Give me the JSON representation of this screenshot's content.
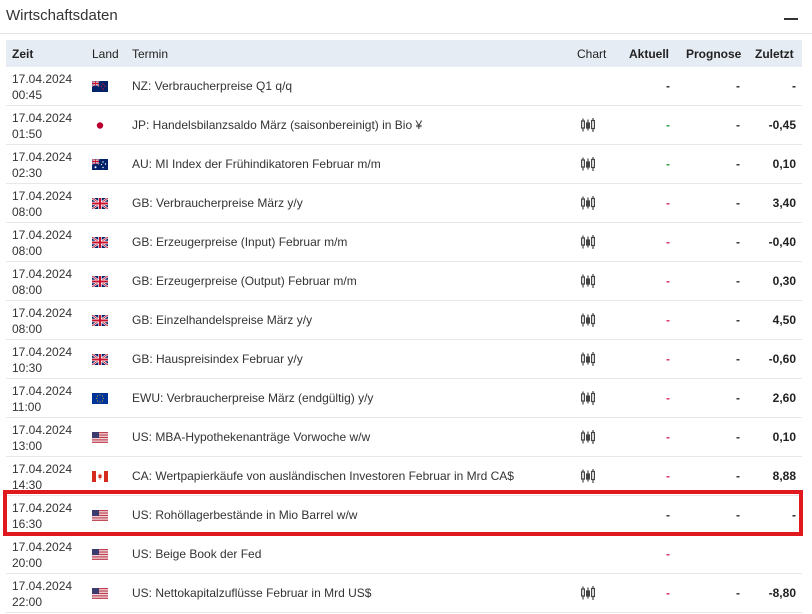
{
  "widget": {
    "title": "Wirtschaftsdaten",
    "collapse_icon": "minus-icon"
  },
  "table": {
    "headers": {
      "time": "Zeit",
      "country": "Land",
      "term": "Termin",
      "chart": "Chart",
      "actual": "Aktuell",
      "forecast": "Prognose",
      "previous": "Zuletzt"
    },
    "rows": [
      {
        "date": "17.04.2024",
        "time": "00:45",
        "flag": "nz",
        "term": "NZ: Verbraucherpreise Q1 q/q",
        "chart": false,
        "actual": "-",
        "actual_style": "plain",
        "forecast": "-",
        "previous": "-"
      },
      {
        "date": "17.04.2024",
        "time": "01:50",
        "flag": "jp",
        "term": "JP: Handelsbilanzsaldo März (saisonbereinigt) in Bio ¥",
        "chart": true,
        "actual": "-",
        "actual_style": "green",
        "forecast": "-",
        "previous": "-0,45"
      },
      {
        "date": "17.04.2024",
        "time": "02:30",
        "flag": "au",
        "term": "AU: MI Index der Frühindikatoren Februar m/m",
        "chart": true,
        "actual": "-",
        "actual_style": "green",
        "forecast": "-",
        "previous": "0,10"
      },
      {
        "date": "17.04.2024",
        "time": "08:00",
        "flag": "gb",
        "term": "GB: Verbraucherpreise März y/y",
        "chart": true,
        "actual": "-",
        "actual_style": "red",
        "forecast": "-",
        "previous": "3,40"
      },
      {
        "date": "17.04.2024",
        "time": "08:00",
        "flag": "gb",
        "term": "GB: Erzeugerpreise (Input) Februar m/m",
        "chart": true,
        "actual": "-",
        "actual_style": "red",
        "forecast": "-",
        "previous": "-0,40"
      },
      {
        "date": "17.04.2024",
        "time": "08:00",
        "flag": "gb",
        "term": "GB: Erzeugerpreise (Output) Februar m/m",
        "chart": true,
        "actual": "-",
        "actual_style": "red",
        "forecast": "-",
        "previous": "0,30"
      },
      {
        "date": "17.04.2024",
        "time": "08:00",
        "flag": "gb",
        "term": "GB: Einzelhandelspreise März y/y",
        "chart": true,
        "actual": "-",
        "actual_style": "red",
        "forecast": "-",
        "previous": "4,50"
      },
      {
        "date": "17.04.2024",
        "time": "10:30",
        "flag": "gb",
        "term": "GB: Hauspreisindex Februar y/y",
        "chart": true,
        "actual": "-",
        "actual_style": "red",
        "forecast": "-",
        "previous": "-0,60"
      },
      {
        "date": "17.04.2024",
        "time": "11:00",
        "flag": "eu",
        "term": "EWU: Verbraucherpreise März (endgültig) y/y",
        "chart": true,
        "actual": "-",
        "actual_style": "red",
        "forecast": "-",
        "previous": "2,60"
      },
      {
        "date": "17.04.2024",
        "time": "13:00",
        "flag": "us",
        "term": "US: MBA-Hypothekenanträge Vorwoche w/w",
        "chart": true,
        "actual": "-",
        "actual_style": "red",
        "forecast": "-",
        "previous": "0,10"
      },
      {
        "date": "17.04.2024",
        "time": "14:30",
        "flag": "ca",
        "term": "CA: Wertpapierkäufe von ausländischen Investoren Februar in Mrd CA$",
        "chart": true,
        "actual": "-",
        "actual_style": "red",
        "forecast": "-",
        "previous": "8,88"
      },
      {
        "date": "17.04.2024",
        "time": "16:30",
        "flag": "us",
        "term": "US: Rohöllagerbestände in Mio Barrel w/w",
        "chart": false,
        "actual": "-",
        "actual_style": "plain",
        "forecast": "-",
        "previous": "-"
      },
      {
        "date": "17.04.2024",
        "time": "20:00",
        "flag": "us",
        "term": "US: Beige Book der Fed",
        "chart": false,
        "actual": "-",
        "actual_style": "red",
        "forecast": "",
        "previous": ""
      },
      {
        "date": "17.04.2024",
        "time": "22:00",
        "flag": "us",
        "term": "US: Nettokapitalzuflüsse Februar in Mrd US$",
        "chart": true,
        "actual": "-",
        "actual_style": "red",
        "forecast": "-",
        "previous": "-8,80"
      }
    ]
  },
  "colors": {
    "header_bg": "#e6ecf3",
    "highlight": "#e0191f",
    "green": "#2f9e44",
    "red": "#d6336c"
  }
}
